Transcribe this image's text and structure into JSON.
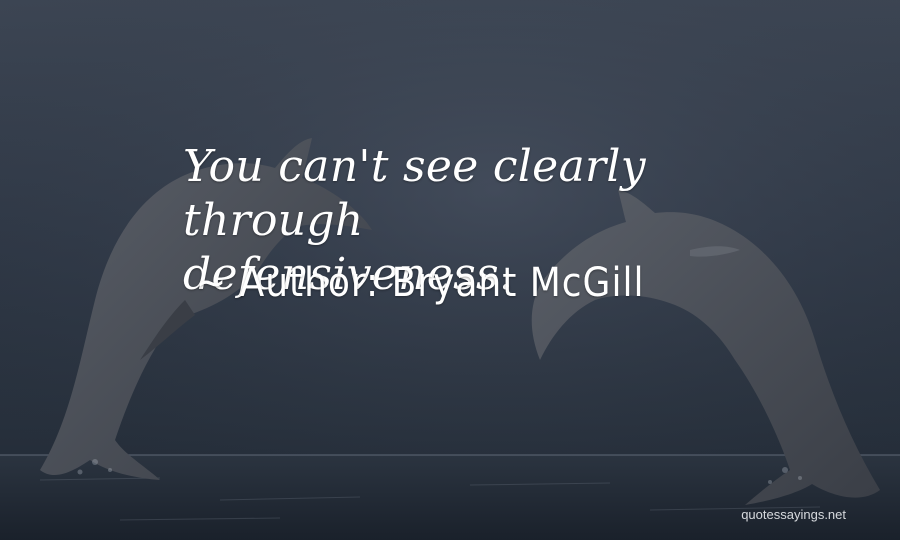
{
  "quote": {
    "line1": "You can't see clearly through",
    "line2": "defensiveness.",
    "author": "~ Author: Bryant McGill"
  },
  "watermark": "quotessayings.net",
  "colors": {
    "sky": "#2f3846",
    "sea": "#1f2733",
    "dolphin": "#4a4f58",
    "text": "#ffffff"
  }
}
